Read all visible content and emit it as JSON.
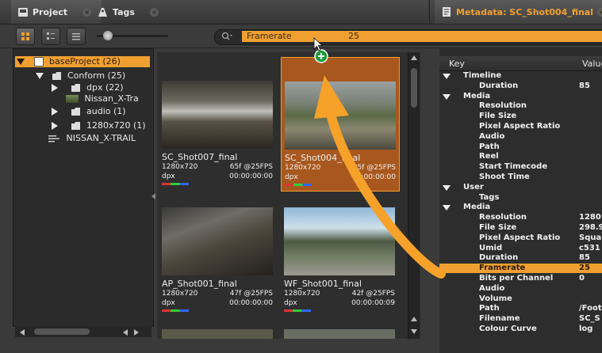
{
  "tabs_left": [
    {
      "label": "Project",
      "icon": "project-icon"
    },
    {
      "label": "Tags",
      "icon": "tags-icon"
    }
  ],
  "tab_right": {
    "label": "Metadata: SC_Shot004_final",
    "icon": "metadata-icon"
  },
  "search": {
    "field": "Framerate",
    "value": "25"
  },
  "tree": [
    {
      "label": "baseProject (26)",
      "level": 0,
      "expander": "down",
      "icon": "project-icon",
      "selected": true
    },
    {
      "label": "Conform (25)",
      "level": 1,
      "expander": "down",
      "icon": "folder-icon"
    },
    {
      "label": "dpx (22)",
      "level": 2,
      "expander": "right",
      "icon": "folder-icon"
    },
    {
      "label": "Nissan_X-Tra",
      "level": 2,
      "expander": "",
      "icon": "clip-thumb-icon"
    },
    {
      "label": "audio (1)",
      "level": 2,
      "expander": "right",
      "icon": "folder-icon"
    },
    {
      "label": "1280x720 (1)",
      "level": 2,
      "expander": "right",
      "icon": "folder-icon"
    },
    {
      "label": "NISSAN_X-TRAIL",
      "level": 1,
      "expander": "",
      "icon": "sequence-icon"
    }
  ],
  "clips": [
    {
      "name": "SC_Shot007_final",
      "res": "1280x720",
      "frames": "65f @25FPS",
      "format": "dpx",
      "tc": "00:00:00:00",
      "selected": false
    },
    {
      "name": "SC_Shot004_final",
      "res": "1280x720",
      "frames": "85f @25FPS",
      "format": "dpx",
      "tc": "00:00:00:00",
      "selected": true
    },
    {
      "name": "AP_Shot001_final",
      "res": "1280x720",
      "frames": "47f @25FPS",
      "format": "dpx",
      "tc": "00:00:00:00",
      "selected": false
    },
    {
      "name": "WF_Shot001_final",
      "res": "1280x720",
      "frames": "42f @25FPS",
      "format": "dpx",
      "tc": "00:00:00:09",
      "selected": false
    }
  ],
  "metadata": {
    "col_key": "Key",
    "col_value": "Value",
    "rows": [
      {
        "key": "Timeline",
        "value": "",
        "level": 0,
        "group": true
      },
      {
        "key": "Duration",
        "value": "85",
        "level": 1,
        "group": false
      },
      {
        "key": "Media",
        "value": "",
        "level": 0,
        "group": true
      },
      {
        "key": "Resolution",
        "value": "",
        "level": 1,
        "group": false
      },
      {
        "key": "File Size",
        "value": "",
        "level": 1,
        "group": false
      },
      {
        "key": "Pixel Aspect Ratio",
        "value": "",
        "level": 1,
        "group": false
      },
      {
        "key": "Audio",
        "value": "",
        "level": 1,
        "group": false
      },
      {
        "key": "Path",
        "value": "",
        "level": 1,
        "group": false
      },
      {
        "key": "Reel",
        "value": "",
        "level": 1,
        "group": false
      },
      {
        "key": "Start Timecode",
        "value": "",
        "level": 1,
        "group": false
      },
      {
        "key": "Shoot Time",
        "value": "",
        "level": 1,
        "group": false
      },
      {
        "key": "User",
        "value": "",
        "level": 0,
        "group": true
      },
      {
        "key": "Tags",
        "value": "",
        "level": 1,
        "group": false
      },
      {
        "key": "Media",
        "value": "",
        "level": 0,
        "group": true
      },
      {
        "key": "Resolution",
        "value": "1280",
        "level": 1,
        "group": false
      },
      {
        "key": "File Size",
        "value": "298.9",
        "level": 1,
        "group": false
      },
      {
        "key": "Pixel Aspect Ratio",
        "value": "Squa",
        "level": 1,
        "group": false
      },
      {
        "key": "Umid",
        "value": "c531",
        "level": 1,
        "group": false
      },
      {
        "key": "Duration",
        "value": "85",
        "level": 1,
        "group": false
      },
      {
        "key": "Framerate",
        "value": "25",
        "level": 1,
        "group": false,
        "highlight": true
      },
      {
        "key": "Bits per Channel",
        "value": "0",
        "level": 1,
        "group": false
      },
      {
        "key": "Audio",
        "value": "",
        "level": 1,
        "group": false
      },
      {
        "key": "Volume",
        "value": "",
        "level": 1,
        "group": false
      },
      {
        "key": "Path",
        "value": "/Foot",
        "level": 1,
        "group": false
      },
      {
        "key": "Filename",
        "value": "SC_S",
        "level": 1,
        "group": false
      },
      {
        "key": "Colour Curve",
        "value": "log",
        "level": 1,
        "group": false
      }
    ]
  },
  "colors": {
    "accent": "#f0a030",
    "panel": "#2d2d2d",
    "bg": "#3a3a3a"
  }
}
